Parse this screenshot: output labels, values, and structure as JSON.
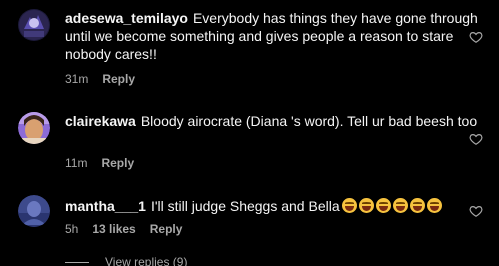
{
  "comments": [
    {
      "username": "adesewa_temilayo",
      "text": "Everybody has things they have gone through until we become something and gives people a reason to stare nobody cares!!",
      "time": "31m",
      "reply_label": "Reply",
      "avatar_color": "#2b2550"
    },
    {
      "username": "clairekawa",
      "text": "Bloody airocrate (Diana 's word). Tell ur bad beesh too",
      "time": "11m",
      "reply_label": "Reply",
      "avatar_color": "#8c6bd6"
    },
    {
      "username": "mantha___1",
      "text": "I'll still judge Sheggs and Bella",
      "emoji_count": 6,
      "emoji_icon": "face-with-tears-of-joy-icon",
      "time": "5h",
      "likes": "13 likes",
      "reply_label": "Reply",
      "avatar_color": "#3d4a8c"
    }
  ],
  "view_replies": "View replies (9)",
  "colors": {
    "background": "#000000",
    "text": "#f5f5f5",
    "secondary": "#a8a8a8"
  }
}
